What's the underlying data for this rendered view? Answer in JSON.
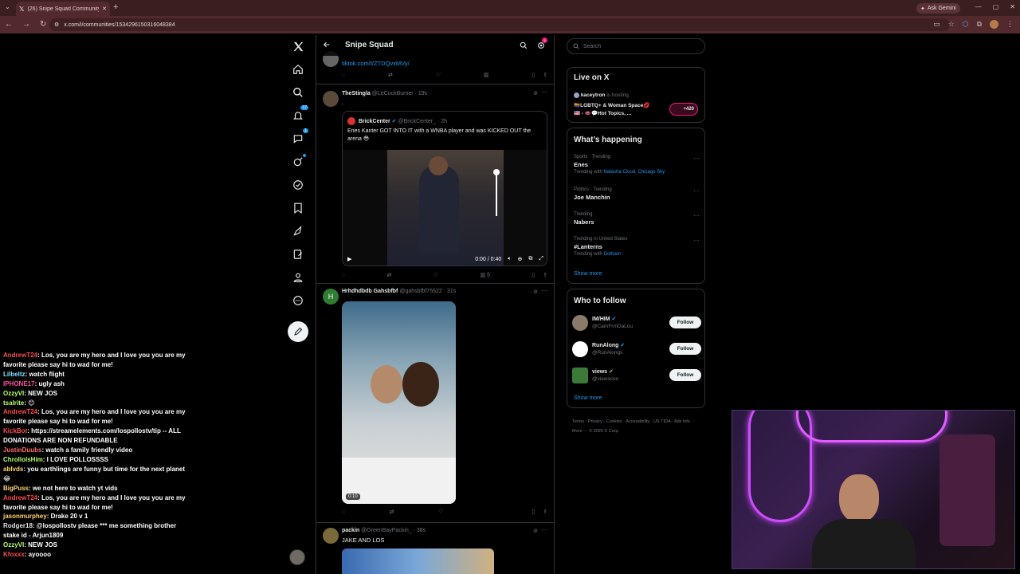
{
  "browser": {
    "tab_title": "(26) Snipe Squad Community /",
    "url": "x.com/i/communities/1534296150316048384",
    "ask_gemini": "Ask Gemini"
  },
  "chat": [
    {
      "user": "AndrewT24",
      "color": "#ff4c4c",
      "text": "Los, you are my hero and I love you you are my favorite please say hi to wad for me!"
    },
    {
      "user": "Lilbeltz",
      "color": "#7fe0ff",
      "text": "watch flight"
    },
    {
      "user": "IPHONE17",
      "color": "#ff4c9a",
      "text": "ugly ash"
    },
    {
      "user": "OzzyVI",
      "color": "#b8ff6a",
      "text": "NEW JOS"
    },
    {
      "user": "tsalrite",
      "color": "#b8ff6a",
      "text": "😊"
    },
    {
      "user": "AndrewT24",
      "color": "#ff4c4c",
      "text": "Los, you are my hero and I love you you are my favorite please say hi to wad for me!"
    },
    {
      "user": "KickBot",
      "color": "#ff4c4c",
      "text": "https://streamelements.com/lospollostv/tip -- ALL DONATIONS ARE NON REFUNDABLE"
    },
    {
      "user": "JustinDuubs",
      "color": "#ff6a6a",
      "text": "watch a family friendly video"
    },
    {
      "user": "ChrollolsHim",
      "color": "#b8ff6a",
      "text": "I LOVE POLLOSSSS"
    },
    {
      "user": "ablvds",
      "color": "#ffd86a",
      "text": "you earthlings are funny but time for the next planet😂"
    },
    {
      "user": "BigPuss",
      "color": "#ffd86a",
      "text": "we not here to watch yt vids"
    },
    {
      "user": "AndrewT24",
      "color": "#ff4c4c",
      "text": "Los, you are my hero and I love you you are my favorite please say hi to wad for me!"
    },
    {
      "user": "jasonmurphey",
      "color": "#ffd86a",
      "text": "Drake 20 v 1"
    },
    {
      "user": "Rodger18",
      "color": "#e0e0e0",
      "text": "@lospollostv please *** me something brother stake id - Arjun1809"
    },
    {
      "user": "OzzyVI",
      "color": "#b8ff6a",
      "text": "NEW JOS"
    },
    {
      "user": "Kfoxxx",
      "color": "#ff4c4c",
      "text": "ayoooo"
    }
  ],
  "nav": {
    "notifications_badge": "17",
    "messages_badge": "1"
  },
  "feed": {
    "community_name": "Snipe Squad",
    "settings_badge": "4",
    "tweets": [
      {
        "link": "tiktok.com/t/ZTDQvxMVy/"
      },
      {
        "name": "TheStingla",
        "handle": "@LeCuckBurner",
        "time": "· 19s",
        "text": ".",
        "quote": {
          "name": "BrickCenter",
          "handle": "@BrickCenter_",
          "time": "· 2h",
          "text": "Enes Kanter GOT INTO IT with a WNBA player and was KICKED OUT the arena 😳",
          "video_time": "0:00 / 0:40"
        },
        "views": "5"
      },
      {
        "name": "Hrhdhdbdb Gahsbfbf",
        "handle": "@gahsbfbf75522",
        "time": "· 31s",
        "avatar_letter": "H",
        "duration": "0:10"
      },
      {
        "name": "packin",
        "handle": "@GreenBayPackin_",
        "time": "· 38s",
        "text": "JAKE AND LOS"
      }
    ]
  },
  "sidebar": {
    "search_placeholder": "Search",
    "live": {
      "title": "Live on X",
      "host": "kaceytron",
      "hosting": "is hosting",
      "line1": "🏳️‍🌈LGBTQ+ & Woman Space💋",
      "line2": "🇺🇸 - 👄💬Hot Topics, ...",
      "count": "+420"
    },
    "happening": {
      "title": "What’s happening",
      "trends": [
        {
          "meta": "Sports · Trending",
          "title": "Enes",
          "with": "Trending with",
          "links": "Natasha Cloud, Chicago Sky"
        },
        {
          "meta": "Politics · Trending",
          "title": "Joe Manchin",
          "with": "",
          "links": ""
        },
        {
          "meta": "Trending",
          "title": "Nabers",
          "with": "",
          "links": ""
        },
        {
          "meta": "Trending in United States",
          "title": "#Lanterns",
          "with": "Trending with",
          "links": "Gotham"
        }
      ],
      "show_more": "Show more"
    },
    "follow": {
      "title": "Who to follow",
      "accounts": [
        {
          "name": "IM/HIM",
          "handle": "@CamFrmDaLou",
          "avatar_color": "#8a7a6a"
        },
        {
          "name": "RunAlong",
          "handle": "@RunAlongs",
          "avatar_color": "#ffffff"
        },
        {
          "name": "views",
          "handle": "@viewsceo",
          "avatar_color": "#3d7a3a"
        }
      ],
      "button": "Follow",
      "show_more": "Show more"
    },
    "footer": "Terms · Privacy · Cookies · Accessibility · US TIDA · Ads info · More ··· © 2025 X Corp."
  }
}
